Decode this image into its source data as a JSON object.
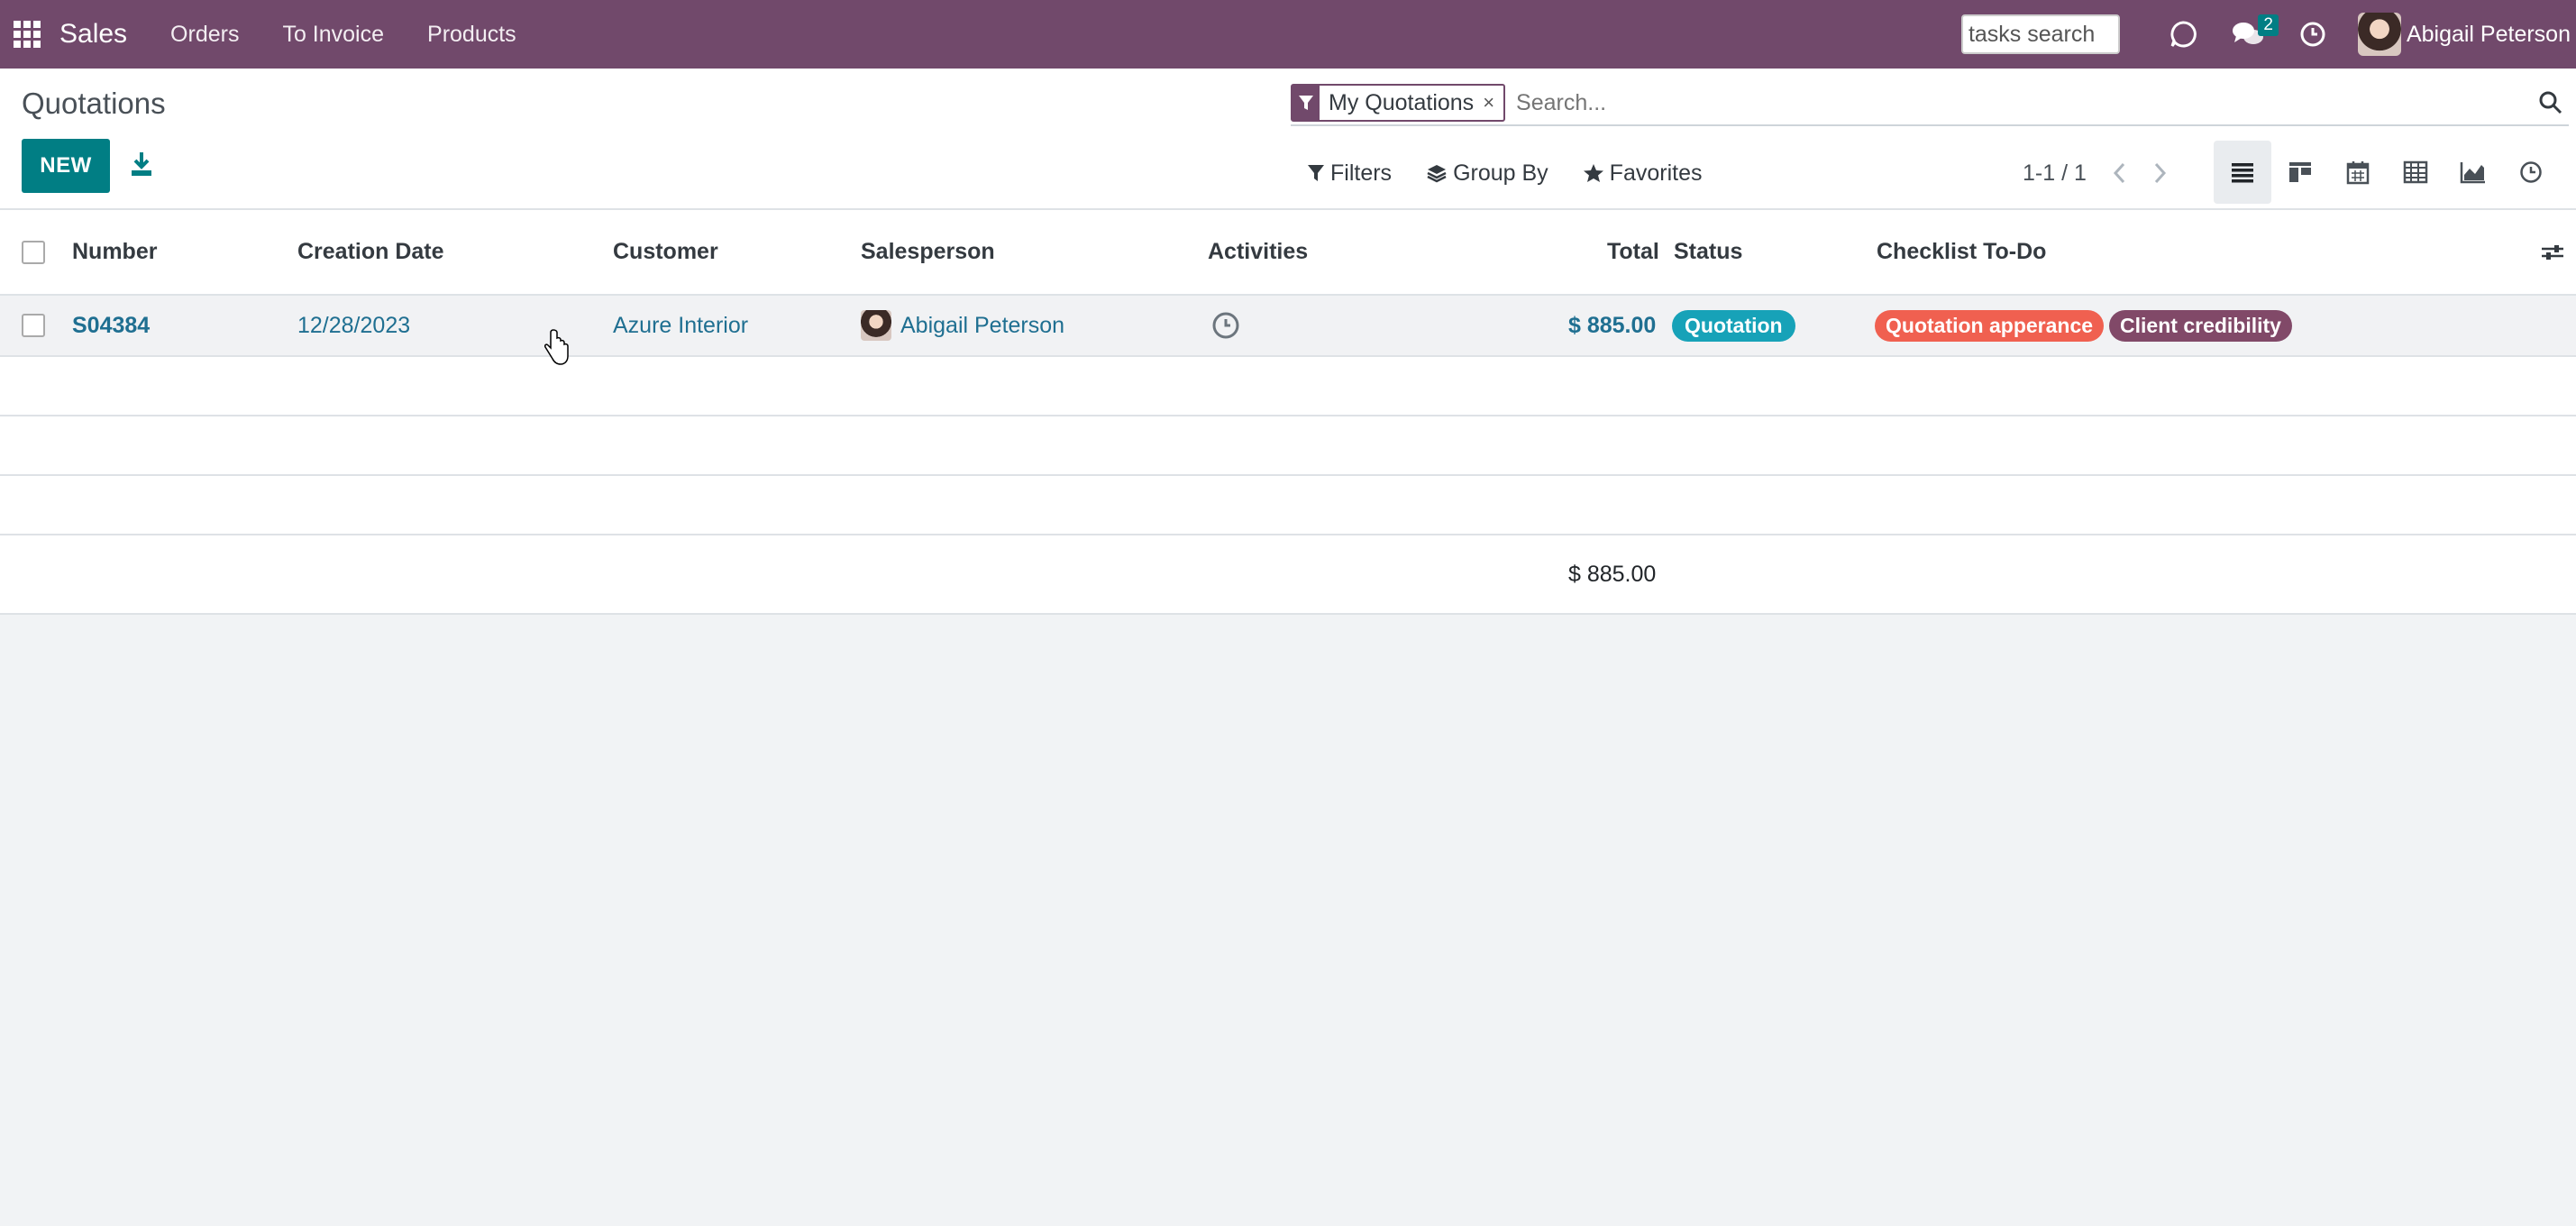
{
  "navbar": {
    "app_name": "Sales",
    "menu": [
      "Orders",
      "To Invoice",
      "Products"
    ],
    "tasks_search": "tasks search",
    "messages_count": "2",
    "user_name": "Abigail Peterson",
    "icons": [
      "apps-grid-icon",
      "discuss-icon",
      "chat-bubbles-icon",
      "clock-icon"
    ],
    "bg_color": "#71496b"
  },
  "control": {
    "breadcrumb": "Quotations",
    "new_label": "NEW",
    "facet_label": "My Quotations",
    "facet_remove": "×",
    "search_placeholder": "Search...",
    "filters_label": "Filters",
    "group_by_label": "Group By",
    "favorites_label": "Favorites",
    "pager_text": "1-1 / 1",
    "views": [
      "list",
      "kanban",
      "calendar",
      "pivot",
      "graph",
      "activity"
    ],
    "active_view": "list"
  },
  "table": {
    "columns": [
      "Number",
      "Creation Date",
      "Customer",
      "Salesperson",
      "Activities",
      "Total",
      "Status",
      "Checklist To-Do"
    ],
    "rows": [
      {
        "number": "S04384",
        "creation_date": "12/28/2023",
        "customer": "Azure Interior",
        "salesperson": "Abigail Peterson",
        "total": "$ 885.00",
        "status": "Quotation",
        "checklist": [
          {
            "label": "Quotation apperance",
            "color": "#f06050"
          },
          {
            "label": "Client credibility",
            "color": "#814968"
          }
        ]
      }
    ],
    "footer_total": "$ 885.00"
  },
  "colors": {
    "primary": "#017e84",
    "status_quotation": "#17a2b8",
    "link": "#1f6f91"
  }
}
